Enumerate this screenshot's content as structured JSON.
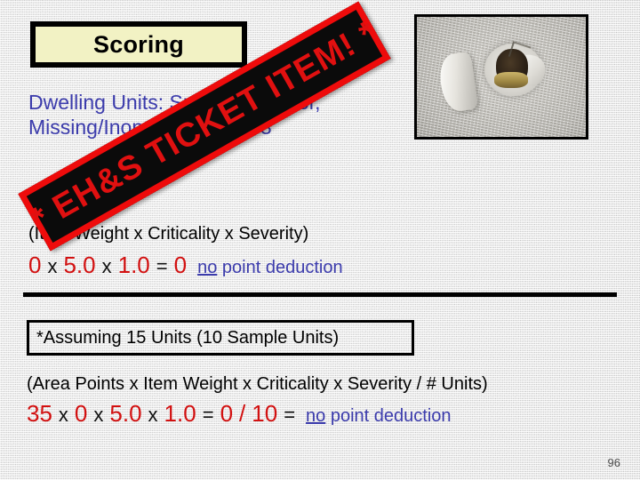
{
  "slide": {
    "title": "Scoring",
    "page_number": "96",
    "background_color": "#ececec"
  },
  "banner": {
    "text": "* EH&S TICKET ITEM! *",
    "text_color": "#e01010",
    "fill_color": "#0b0b0b",
    "border_color": "#ee0b0b"
  },
  "subject": {
    "text": "Dwelling Units: Smoke Detector,\nMissing/Inoperable  Level 3",
    "color": "#3b3bac"
  },
  "photo": {
    "caption": "ceiling-mounted smoke detector base with cover hanging open"
  },
  "item_calc": {
    "label": "(Item Weight x Criticality x Severity)",
    "tokens": [
      {
        "text": "0",
        "kind": "num"
      },
      {
        "text": "x",
        "kind": "op"
      },
      {
        "text": "5.0",
        "kind": "num"
      },
      {
        "text": "x",
        "kind": "op"
      },
      {
        "text": "1.0",
        "kind": "num"
      },
      {
        "text": "=",
        "kind": "op"
      },
      {
        "text": "0",
        "kind": "num"
      }
    ],
    "result_prefix": "no",
    "result_suffix": " point deduction",
    "result_color": "#3b3bac"
  },
  "assuming": {
    "text": "*Assuming 15 Units  (10 Sample Units)"
  },
  "area_calc": {
    "label": "(Area Points x Item Weight x Criticality x Severity / # Units)",
    "tokens": [
      {
        "text": "35",
        "kind": "num"
      },
      {
        "text": "x",
        "kind": "op"
      },
      {
        "text": "0",
        "kind": "num"
      },
      {
        "text": "x",
        "kind": "op"
      },
      {
        "text": "5.0",
        "kind": "num"
      },
      {
        "text": "x",
        "kind": "op"
      },
      {
        "text": "1.0",
        "kind": "num"
      },
      {
        "text": "=",
        "kind": "op"
      },
      {
        "text": "0",
        "kind": "num"
      },
      {
        "text": "/",
        "kind": "num"
      },
      {
        "text": "10",
        "kind": "num"
      },
      {
        "text": "=",
        "kind": "op"
      }
    ],
    "result_prefix": "no",
    "result_suffix": " point deduction",
    "result_color": "#3b3bac"
  },
  "colors": {
    "number_red": "#d21010",
    "operator_black": "#111111",
    "link_blue": "#3b3bac",
    "title_fill": "#f2f2c4"
  }
}
